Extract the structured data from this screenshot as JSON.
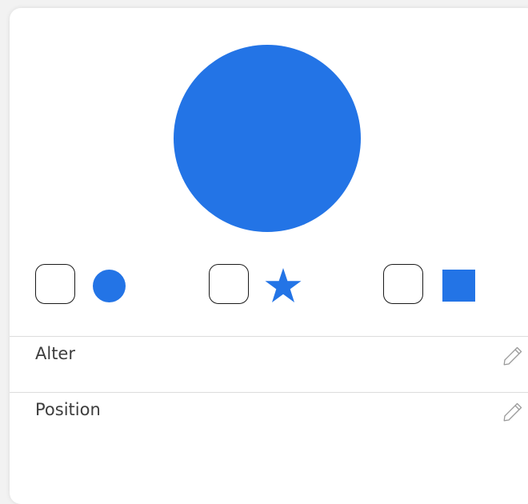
{
  "colors": {
    "accent": "#2374e6",
    "text": "#3d3d3d",
    "divider": "#dddddd"
  },
  "preview": {
    "shape": "circle-shape"
  },
  "shape_options": [
    {
      "shape": "circle-icon",
      "selected": false
    },
    {
      "shape": "star-icon",
      "selected": false
    },
    {
      "shape": "square-icon",
      "selected": false
    }
  ],
  "fields": {
    "alter": {
      "label": "Alter",
      "icon": "pencil-icon"
    },
    "position": {
      "label": "Position",
      "icon": "pencil-icon"
    }
  }
}
